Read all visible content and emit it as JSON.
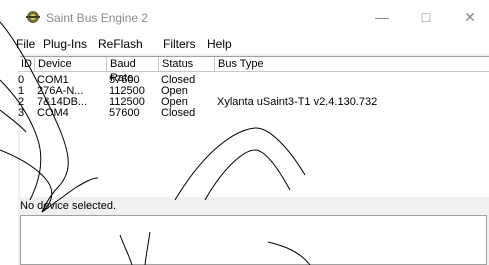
{
  "window": {
    "title": "Saint Bus Engine 2",
    "controls": {
      "minimize": "—",
      "maximize": "□",
      "close": "✕"
    }
  },
  "menu": [
    "File",
    "Plug-Ins",
    "ReFlash",
    "Filters",
    "Help"
  ],
  "devices_table": {
    "columns": [
      "ID",
      "Device",
      "Baud Rate",
      "Status",
      "Bus Type"
    ],
    "rows": [
      [
        "0",
        "COM1",
        "57600",
        "Closed",
        ""
      ],
      [
        "1",
        "276A-N...",
        "112500",
        "Open",
        ""
      ],
      [
        "2",
        "7&14DB...",
        "112500",
        "Open",
        "Xylanta uSaint3-T1 v2.4.130.732"
      ],
      [
        "3",
        "COM4",
        "57600",
        "Closed",
        ""
      ]
    ]
  },
  "status_text": "No device selected."
}
